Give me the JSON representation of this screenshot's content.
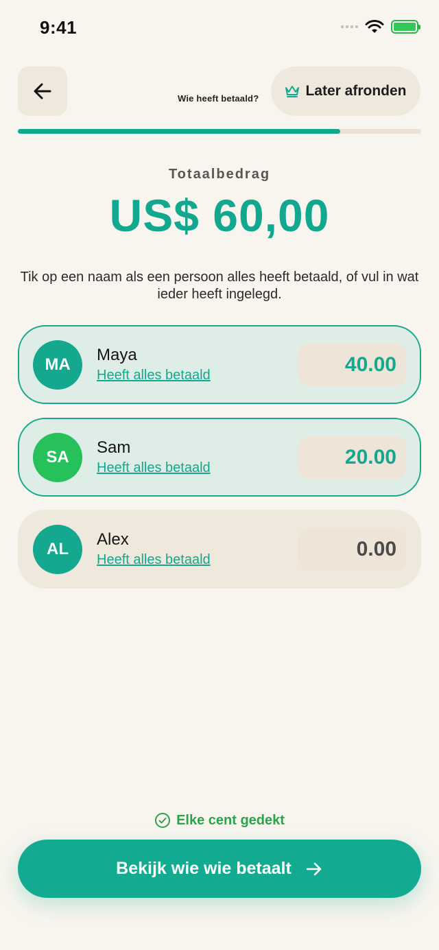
{
  "status_bar": {
    "time": "9:41"
  },
  "header": {
    "title": "Wie heeft betaald?",
    "later_label": "Later afronden",
    "progress": 0.8
  },
  "total": {
    "label": "Totaalbedrag",
    "amount": "US$ 60,00"
  },
  "instruction": "Tik op een naam als een persoon alles heeft betaald, of vul in wat ieder heeft ingelegd.",
  "people": [
    {
      "initials": "MA",
      "name": "Maya",
      "link": "Heeft alles betaald",
      "amount": "40.00",
      "paid": true,
      "avatar_color": "#14a88f",
      "amount_color": "#14a88f"
    },
    {
      "initials": "SA",
      "name": "Sam",
      "link": "Heeft alles betaald",
      "amount": "20.00",
      "paid": true,
      "avatar_color": "#26c15a",
      "amount_color": "#14a88f"
    },
    {
      "initials": "AL",
      "name": "Alex",
      "link": "Heeft alles betaald",
      "amount": "0.00",
      "paid": false,
      "avatar_color": "#14a88f",
      "amount_color": "#4a4a4a"
    }
  ],
  "footer": {
    "covered_label": "Elke cent gedekt",
    "cta_label": "Bekijk wie wie betaalt"
  },
  "colors": {
    "accent": "#12a88f",
    "background": "#f8f5ef",
    "success": "#2aa34a"
  }
}
